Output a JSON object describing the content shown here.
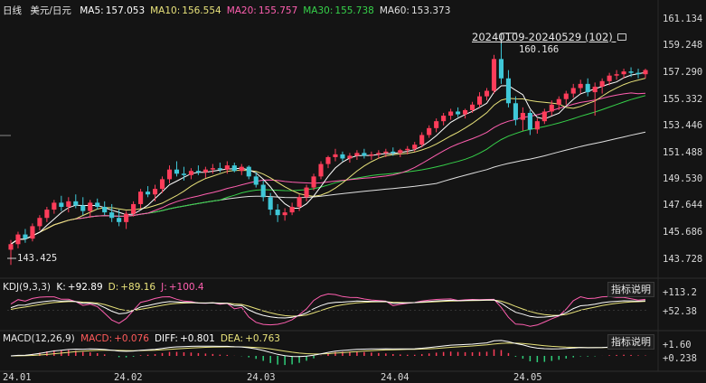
{
  "main_header": {
    "period": "日线",
    "symbol": "美元/日元",
    "indicators": [
      {
        "label": "MA5:",
        "value": "157.053",
        "color": "#ffffff"
      },
      {
        "label": "MA10:",
        "value": "156.554",
        "color": "#e8e27a"
      },
      {
        "label": "MA20:",
        "value": "155.757",
        "color": "#ff5fb0"
      },
      {
        "label": "MA30:",
        "value": "155.738",
        "color": "#36d14a"
      },
      {
        "label": "MA60:",
        "value": "153.373",
        "color": "#e0e0e0"
      }
    ]
  },
  "price_axis": [
    "161.134",
    "159.248",
    "157.290",
    "155.332",
    "153.446",
    "151.488",
    "149.530",
    "147.644",
    "145.686",
    "143.728"
  ],
  "range_label": "20240109-20240529 (102)",
  "high_marker": "160.166",
  "low_marker": "143.425",
  "kdj": {
    "title": "KDJ(9,3,3)",
    "items": [
      {
        "label": "K:",
        "value": "+92.89",
        "color": "#ffffff"
      },
      {
        "label": "D:",
        "value": "+89.16",
        "color": "#e8e27a"
      },
      {
        "label": "J:",
        "value": "+100.4",
        "color": "#ff5fb0"
      }
    ],
    "axis": [
      "+113.2",
      "+52.38"
    ],
    "button": "指标说明"
  },
  "macd": {
    "title": "MACD(12,26,9)",
    "items": [
      {
        "label": "MACD:",
        "value": "+0.076",
        "color": "#ff5a5a"
      },
      {
        "label": "DIFF:",
        "value": "+0.801",
        "color": "#ffffff"
      },
      {
        "label": "DEA:",
        "value": "+0.763",
        "color": "#e8e27a"
      }
    ],
    "axis": [
      "+1.60",
      "+0.238"
    ],
    "button": "指标说明"
  },
  "time_axis": [
    "24.01",
    "24.02",
    "24.03",
    "24.04",
    "24.05"
  ],
  "colors": {
    "up": "#ff3d5a",
    "down": "#3fc8d8",
    "background": "#141414"
  },
  "chart_data": {
    "type": "candlestick",
    "ylim": [
      142.5,
      161.134
    ],
    "candles": [
      [
        144.5,
        145.2,
        143.4,
        144.9
      ],
      [
        144.9,
        145.8,
        144.6,
        145.6
      ],
      [
        145.6,
        146.0,
        145.0,
        145.3
      ],
      [
        145.3,
        146.4,
        145.1,
        146.2
      ],
      [
        146.2,
        147.0,
        145.9,
        146.8
      ],
      [
        146.8,
        147.6,
        146.5,
        147.4
      ],
      [
        147.4,
        148.1,
        147.1,
        147.9
      ],
      [
        147.9,
        148.4,
        147.3,
        147.6
      ],
      [
        147.6,
        148.3,
        147.2,
        148.0
      ],
      [
        148.0,
        148.5,
        147.5,
        147.7
      ],
      [
        147.7,
        148.3,
        147.0,
        147.3
      ],
      [
        147.3,
        148.1,
        146.8,
        147.9
      ],
      [
        147.9,
        148.2,
        147.4,
        147.6
      ],
      [
        147.6,
        148.0,
        147.0,
        147.2
      ],
      [
        147.2,
        147.8,
        146.5,
        146.8
      ],
      [
        146.8,
        147.4,
        146.2,
        146.5
      ],
      [
        146.5,
        147.3,
        146.0,
        147.1
      ],
      [
        147.1,
        148.0,
        146.9,
        147.8
      ],
      [
        147.8,
        148.9,
        147.5,
        148.7
      ],
      [
        148.7,
        149.1,
        148.3,
        148.5
      ],
      [
        148.5,
        149.2,
        148.0,
        148.9
      ],
      [
        148.9,
        149.8,
        148.6,
        149.6
      ],
      [
        149.6,
        150.6,
        149.3,
        150.3
      ],
      [
        150.3,
        150.9,
        149.8,
        150.0
      ],
      [
        150.0,
        150.5,
        149.5,
        149.9
      ],
      [
        149.9,
        150.4,
        149.6,
        150.2
      ],
      [
        150.2,
        150.6,
        149.9,
        150.1
      ],
      [
        150.1,
        150.5,
        149.7,
        150.3
      ],
      [
        150.3,
        150.7,
        150.0,
        150.4
      ],
      [
        150.4,
        150.8,
        150.1,
        150.3
      ],
      [
        150.3,
        150.9,
        150.0,
        150.6
      ],
      [
        150.6,
        150.8,
        150.1,
        150.2
      ],
      [
        150.2,
        150.7,
        149.9,
        150.5
      ],
      [
        150.5,
        150.6,
        149.6,
        149.8
      ],
      [
        149.8,
        150.1,
        149.0,
        149.2
      ],
      [
        149.2,
        149.5,
        148.0,
        148.3
      ],
      [
        148.3,
        148.6,
        147.0,
        147.4
      ],
      [
        147.4,
        147.8,
        146.5,
        147.0
      ],
      [
        147.0,
        147.5,
        146.6,
        147.2
      ],
      [
        147.2,
        147.9,
        147.0,
        147.6
      ],
      [
        147.6,
        148.5,
        147.3,
        148.3
      ],
      [
        148.3,
        149.2,
        148.0,
        149.0
      ],
      [
        149.0,
        150.0,
        148.8,
        149.8
      ],
      [
        149.8,
        150.9,
        149.6,
        150.7
      ],
      [
        150.7,
        151.3,
        150.4,
        151.2
      ],
      [
        151.2,
        151.8,
        150.9,
        151.4
      ],
      [
        151.4,
        151.6,
        150.9,
        151.1
      ],
      [
        151.1,
        151.5,
        150.8,
        151.3
      ],
      [
        151.3,
        151.7,
        151.0,
        151.5
      ],
      [
        151.5,
        151.8,
        151.1,
        151.3
      ],
      [
        151.3,
        151.6,
        151.0,
        151.4
      ],
      [
        151.4,
        151.7,
        151.1,
        151.5
      ],
      [
        151.5,
        151.8,
        151.2,
        151.6
      ],
      [
        151.6,
        151.9,
        151.3,
        151.5
      ],
      [
        151.5,
        151.8,
        151.2,
        151.7
      ],
      [
        151.7,
        152.0,
        151.4,
        151.8
      ],
      [
        151.8,
        152.3,
        151.6,
        152.1
      ],
      [
        152.1,
        153.0,
        151.9,
        152.8
      ],
      [
        152.8,
        153.5,
        152.6,
        153.3
      ],
      [
        153.3,
        154.0,
        153.0,
        153.8
      ],
      [
        153.8,
        154.4,
        153.5,
        154.2
      ],
      [
        154.2,
        154.7,
        153.9,
        154.5
      ],
      [
        154.5,
        154.8,
        154.1,
        154.3
      ],
      [
        154.3,
        154.7,
        154.0,
        154.6
      ],
      [
        154.6,
        155.2,
        154.4,
        155.0
      ],
      [
        155.0,
        155.9,
        154.8,
        155.6
      ],
      [
        155.6,
        156.2,
        155.3,
        156.0
      ],
      [
        156.0,
        158.6,
        155.8,
        158.3
      ],
      [
        158.3,
        160.166,
        156.5,
        156.9
      ],
      [
        156.9,
        157.5,
        154.8,
        155.1
      ],
      [
        155.1,
        155.6,
        153.5,
        153.9
      ],
      [
        153.9,
        154.8,
        153.1,
        154.4
      ],
      [
        154.4,
        154.6,
        152.8,
        153.2
      ],
      [
        153.2,
        154.0,
        152.9,
        153.8
      ],
      [
        153.8,
        154.7,
        153.6,
        154.5
      ],
      [
        154.5,
        155.3,
        154.2,
        155.0
      ],
      [
        155.0,
        155.6,
        154.6,
        155.4
      ],
      [
        155.4,
        156.0,
        155.0,
        155.8
      ],
      [
        155.8,
        156.5,
        155.5,
        156.2
      ],
      [
        156.2,
        156.8,
        155.8,
        156.5
      ],
      [
        156.5,
        156.9,
        155.6,
        155.9
      ],
      [
        155.9,
        156.6,
        154.2,
        156.3
      ],
      [
        156.3,
        156.9,
        155.8,
        156.7
      ],
      [
        156.7,
        157.3,
        156.4,
        157.1
      ],
      [
        157.1,
        157.5,
        156.8,
        157.2
      ],
      [
        157.2,
        157.6,
        156.9,
        157.4
      ],
      [
        157.4,
        157.7,
        157.0,
        157.3
      ],
      [
        157.3,
        157.6,
        156.9,
        157.2
      ],
      [
        157.2,
        157.6,
        156.9,
        157.5
      ]
    ]
  }
}
